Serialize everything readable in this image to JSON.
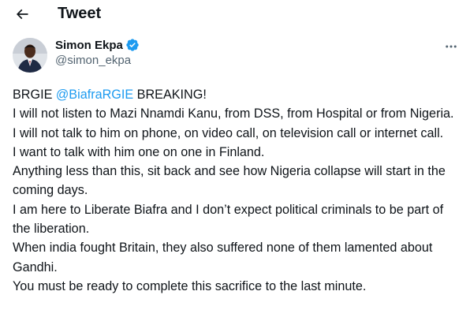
{
  "header": {
    "title": "Tweet",
    "back_icon": "arrow-left-icon"
  },
  "author": {
    "name": "Simon Ekpa",
    "handle": "@simon_ekpa",
    "verified_icon": "verified-badge-icon",
    "more_icon": "more-horizontal-icon"
  },
  "tweet": {
    "prefix": "BRGIE ",
    "mention": "@BiafraRGIE",
    "after_mention": " BREAKING!",
    "lines": [
      "I will not listen to Mazi Nnamdi Kanu, from DSS, from Hospital or from Nigeria.",
      "I will not talk to him on phone, on video call, on television call or internet call.",
      "I want to talk with him one on one in Finland.",
      "Anything less than this, sit back and see how Nigeria collapse will start in the coming days.",
      "I am here to Liberate Biafra and I don’t expect political criminals to be part of the liberation.",
      "When india fought Britain, they also suffered none of them lamented about Gandhi.",
      "You must be ready to complete this sacrifice to the last minute."
    ]
  },
  "colors": {
    "text": "#0f1419",
    "secondary": "#536471",
    "accent": "#1d9bf0"
  }
}
